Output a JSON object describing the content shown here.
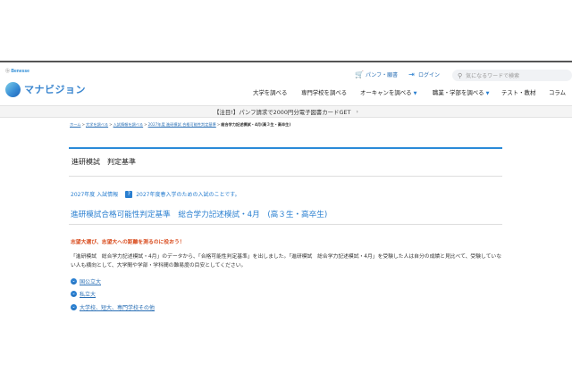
{
  "brand": {
    "small": "Benesse",
    "name": "マナビジョン"
  },
  "util": {
    "pamphlet": "パンフ・願書",
    "login": "ログイン"
  },
  "search": {
    "placeholder": "気になるワードで検索"
  },
  "nav": [
    {
      "label": "大学を調べる",
      "caret": false
    },
    {
      "label": "専門学校を調べる",
      "caret": false
    },
    {
      "label": "オーキャンを調べる",
      "caret": true
    },
    {
      "label": "職業・学部を調べる",
      "caret": true
    },
    {
      "label": "テスト・教材",
      "caret": false
    },
    {
      "label": "コラム",
      "caret": false
    }
  ],
  "promo": {
    "text": "【注目!】パンフ請求で2000円分電子図書カードGET"
  },
  "breadcrumb": {
    "items": [
      "ホーム",
      "大学を調べる",
      "入試情報を調べる",
      "2027年度 進研模試 合格可能性判定基準"
    ],
    "current": "総合学力記述模試・4月(高３生・高卒生)"
  },
  "section_title": "進研模試　判定基準",
  "category": {
    "label": "2027年度 入試情報",
    "note": "2027年度春入学のための入試のことです。"
  },
  "page_title": "進研模試合格可能性判定基準　総合学力記述模試・4月　(高３生・高卒生)",
  "lead": "志望大選び、志望大への距離を測るのに役おう！",
  "body": "「進研模試　総合学力記述模試・4月」のデータから、「合格可能性判定基準」を出しました。「進研模試　総合学力記述模試・4月」を受験した人は自分の成績と見比べて、受験していない人も横向として、大学間や学部・学科間の難易度の目安としてください。",
  "links": [
    "国公立大",
    "私立大",
    "大学校、短大、専門学校その他"
  ],
  "colors": {
    "accent": "#2a7fd0",
    "lead": "#d94c1e"
  }
}
